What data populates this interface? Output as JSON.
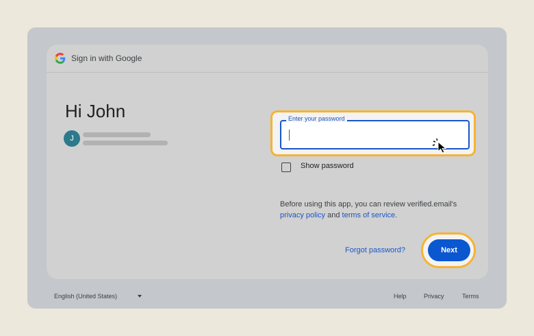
{
  "header": {
    "title": "Sign in with Google",
    "logo_icon": "google-g-logo"
  },
  "account": {
    "greeting": "Hi John",
    "avatar_letter": "J",
    "avatar_color": "#2d7a8c"
  },
  "password": {
    "label": "Enter your password",
    "value": ""
  },
  "show_password": {
    "label": "Show password",
    "checked": false
  },
  "consent": {
    "text_before": "Before using this app, you can review verified.email's",
    "privacy_link": "privacy policy",
    "and": "and",
    "terms_link": "terms of service",
    "period": "."
  },
  "actions": {
    "forgot_label": "Forgot password?",
    "next_label": "Next"
  },
  "footer": {
    "language": "English (United States)",
    "help": "Help",
    "privacy": "Privacy",
    "terms": "Terms"
  },
  "colors": {
    "accent": "#0b57d0",
    "highlight": "#f6b330",
    "background": "#ece8dc"
  }
}
